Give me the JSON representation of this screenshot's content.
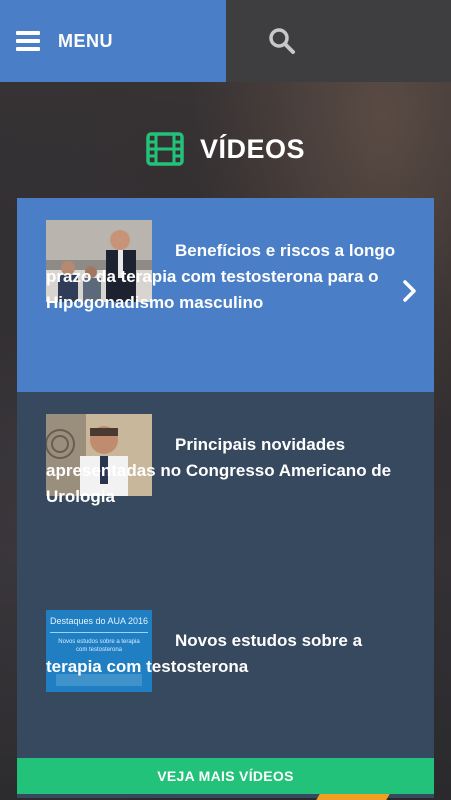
{
  "header": {
    "menu_label": "MENU",
    "menu_bg": "#4a7fc8",
    "search_bg": "#3e3e41"
  },
  "section": {
    "title": "VÍDEOS",
    "icon_color": "#23c27a"
  },
  "videos": [
    {
      "title": "Benefícios e riscos a longo prazo da terapia com testosterona para o Hipogonadismo masculino",
      "active": true
    },
    {
      "title": "Principais novidades apresentadas no Congresso Americano de Urologia",
      "active": false
    },
    {
      "title": "Novos estudos sobre a terapia com testosterona",
      "active": false
    }
  ],
  "thumb3": {
    "heading": "Destaques do AUA 2016",
    "subheading": "Novos estudos sobre a terapia com testosterona"
  },
  "cta_label": "VEJA MAIS VÍDEOS"
}
